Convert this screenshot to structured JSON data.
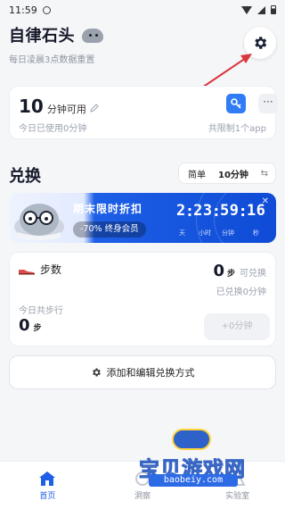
{
  "status_bar": {
    "time": "11:59"
  },
  "header": {
    "title": "自律石头",
    "subtitle": "每日凌晨3点数据重置"
  },
  "usage_card": {
    "minutes": "10",
    "unit": "分钟可用",
    "used_today": "今日已使用0分钟",
    "limit": "共限制1个app",
    "more": "···"
  },
  "exchange": {
    "title": "兑换",
    "mode_simple": "简单",
    "mode_value": "10分钟"
  },
  "promo": {
    "title": "期末限时折扣",
    "offer": "-70% 终身会员",
    "timer": {
      "days": "2",
      "hours": "23",
      "minutes": "59",
      "seconds": "16"
    },
    "labels": {
      "days": "天",
      "hours": "小时",
      "minutes": "分钟",
      "seconds": "秒"
    },
    "close": "✕"
  },
  "steps_card": {
    "name": "步数",
    "available": "0",
    "unit": "步",
    "available_label": "可兑换",
    "redeemed": "已兑换0分钟",
    "today_label": "今日共步行",
    "today_steps": "0",
    "today_unit": "步",
    "button": "+0分钟"
  },
  "add_button": {
    "label": "添加和编辑兑换方式"
  },
  "watermark": {
    "text": "宝贝游戏网",
    "url": "baobeiy.com"
  },
  "tabs": [
    {
      "label": "首页",
      "icon": "home-icon",
      "active": true
    },
    {
      "label": "洞察",
      "icon": "insight-icon",
      "active": false
    },
    {
      "label": "实验室",
      "icon": "lab-icon",
      "active": false
    }
  ],
  "colors": {
    "accent": "#1f5fe6",
    "annotation_arrow": "#d9363e"
  }
}
